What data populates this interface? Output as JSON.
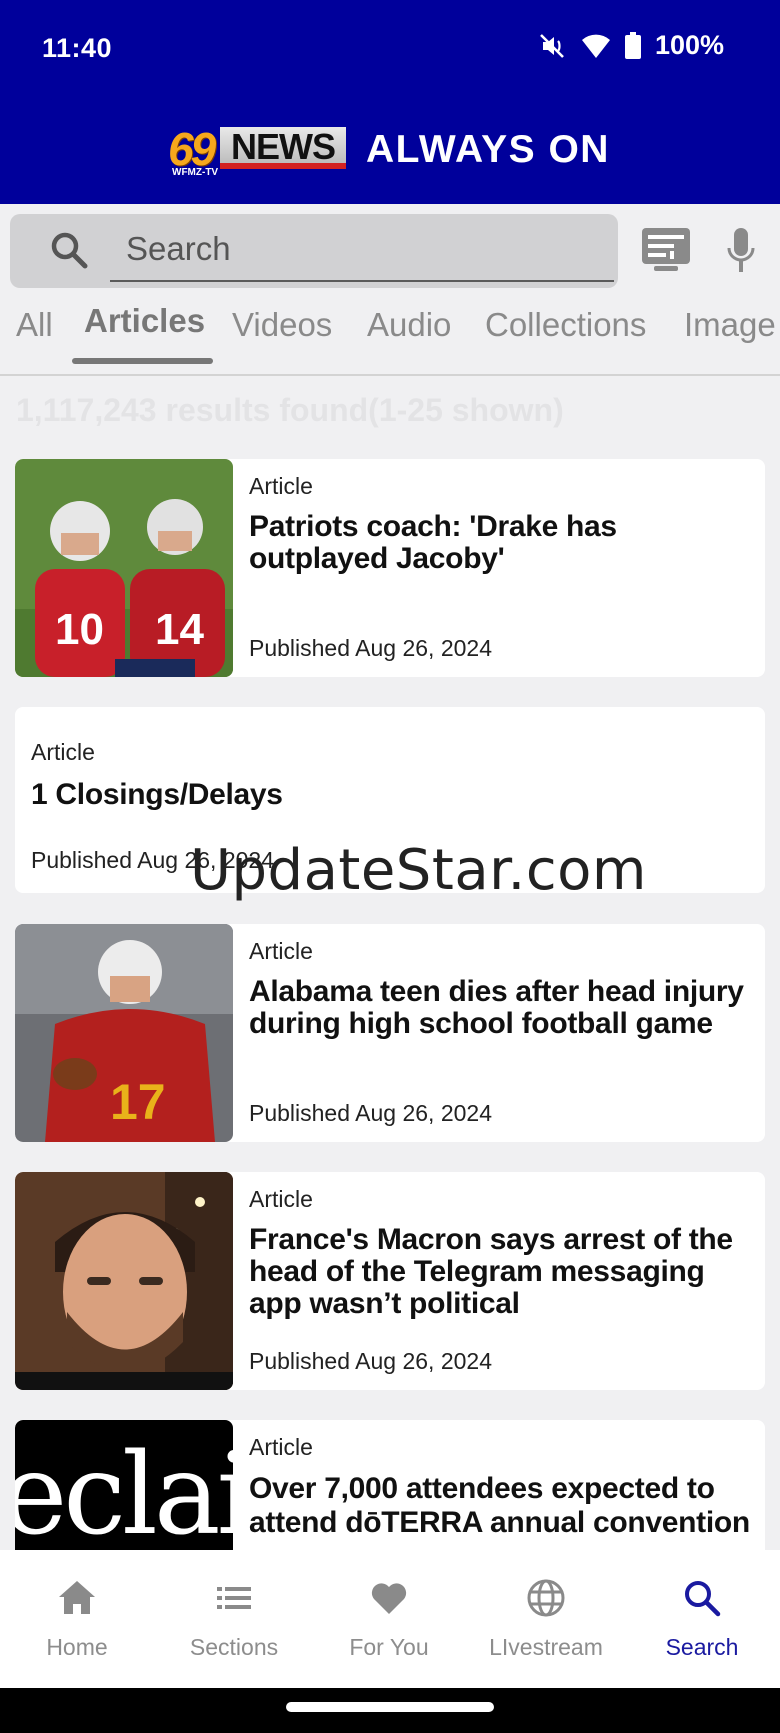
{
  "status_bar": {
    "time": "11:40",
    "battery": "100%"
  },
  "brand": {
    "logo_number": "69",
    "logo_word": "NEWS",
    "logo_sub": "WFMZ-TV",
    "tagline": "ALWAYS ON"
  },
  "search": {
    "placeholder": "Search"
  },
  "tabs": [
    "All",
    "Articles",
    "Videos",
    "Audio",
    "Collections",
    "Image"
  ],
  "active_tab": "Articles",
  "results_text": "1,117,243 results found(1-25 shown)",
  "articles": [
    {
      "type": "Article",
      "title": "Patriots coach: 'Drake has outplayed Jacoby'",
      "date": "Published Aug 26, 2024",
      "image": "football-players-photo"
    },
    {
      "type": "Article",
      "title": "1 Closings/Delays",
      "date": "Published Aug 26, 2024",
      "image": ""
    },
    {
      "type": "Article",
      "title": "Alabama teen dies after head injury during high school football game",
      "date": "Published Aug 26, 2024",
      "image": "football-player-photo"
    },
    {
      "type": "Article",
      "title": "France's Macron says arrest of the head of the Telegram messaging app wasn’t political",
      "date": "Published Aug 26, 2024",
      "image": "man-portrait-photo"
    },
    {
      "type": "Article",
      "title": "Over 7,000 attendees expected to attend dōTERRA annual convention",
      "date": "",
      "image": "eclair-logo",
      "image_text": "eclai"
    }
  ],
  "watermark": "UpdateStar.com",
  "bottom_nav": [
    {
      "label": "Home",
      "icon": "home-icon"
    },
    {
      "label": "Sections",
      "icon": "list-icon"
    },
    {
      "label": "For You",
      "icon": "heart-icon"
    },
    {
      "label": "LIvestream",
      "icon": "globe-icon"
    },
    {
      "label": "Search",
      "icon": "search-icon"
    }
  ],
  "colors": {
    "brand_blue": "#00009b",
    "active_nav": "#1a1aa0",
    "page_bg": "#f0f0f2"
  }
}
